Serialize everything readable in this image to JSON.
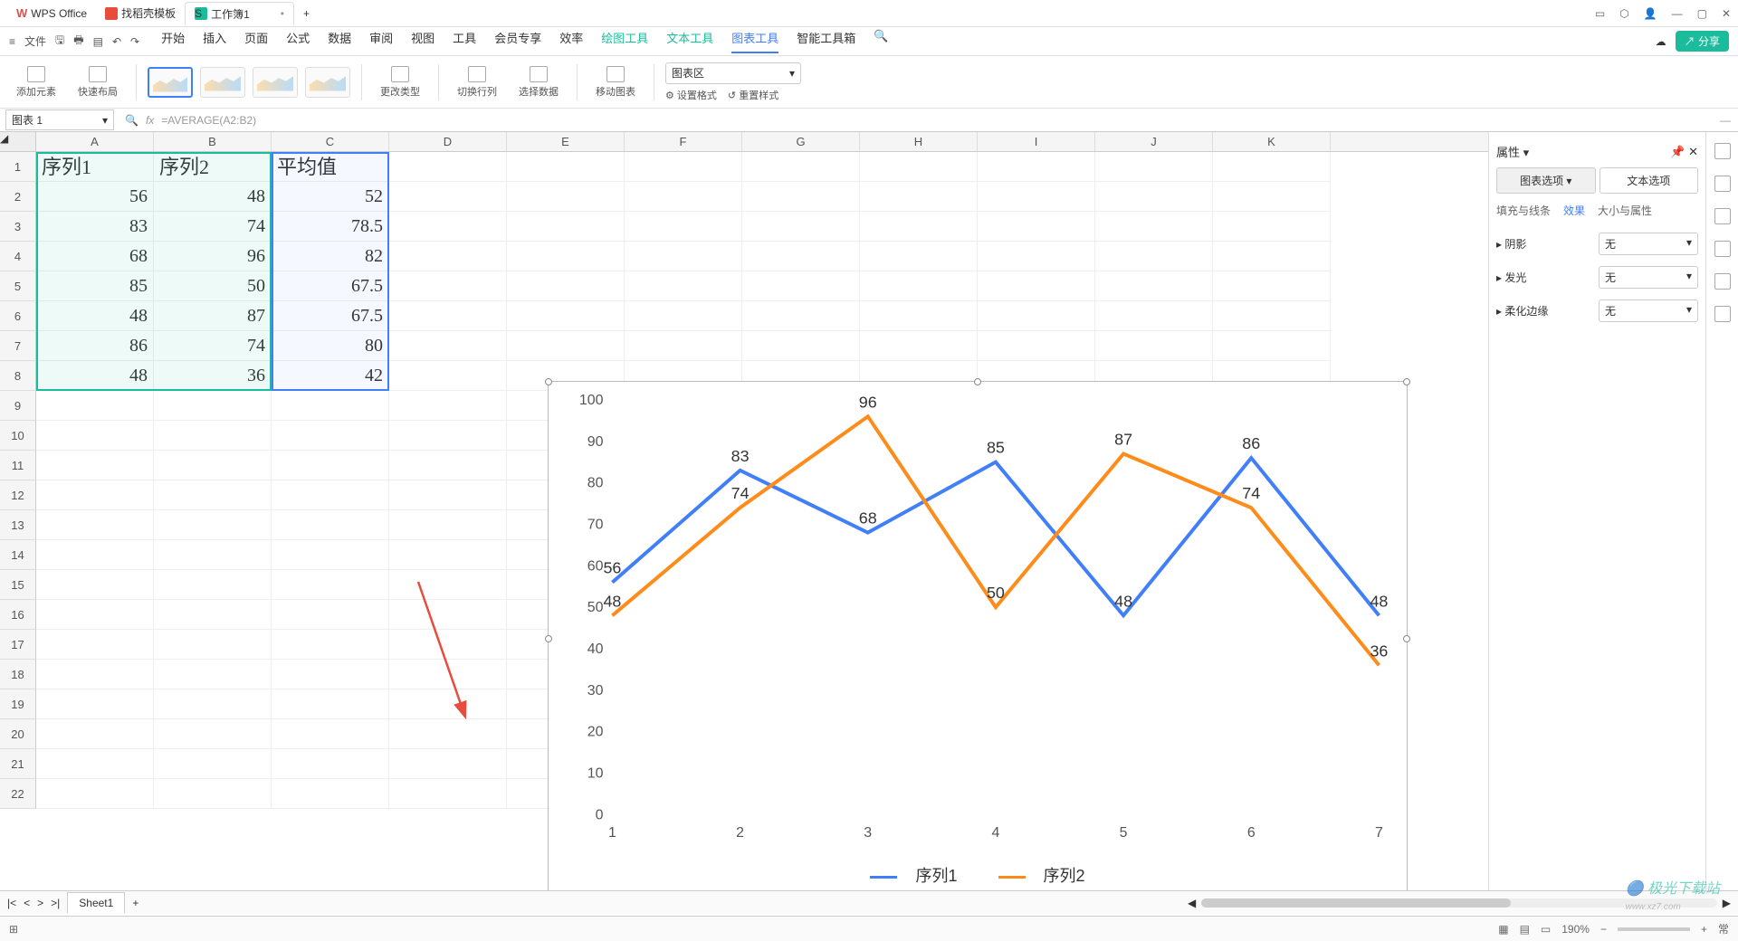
{
  "titlebar": {
    "app": "WPS Office",
    "tab_template": "找稻壳模板",
    "tab_workbook": "工作簿1",
    "plus": "+"
  },
  "menu": {
    "file": "文件",
    "items": [
      "开始",
      "插入",
      "页面",
      "公式",
      "数据",
      "审阅",
      "视图",
      "工具",
      "会员专享",
      "效率"
    ],
    "green_items": [
      "绘图工具",
      "文本工具"
    ],
    "active": "图表工具",
    "after": [
      "智能工具箱"
    ],
    "share": "分享"
  },
  "ribbon": {
    "add_element": "添加元素",
    "quick_layout": "快速布局",
    "change_type": "更改类型",
    "switch_rc": "切换行列",
    "select_data": "选择数据",
    "move_chart": "移动图表",
    "chart_area": "图表区",
    "set_format": "设置格式",
    "reset_style": "重置样式"
  },
  "formula": {
    "name": "图表 1",
    "fx": "=AVERAGE(A2:B2)"
  },
  "cols": [
    "A",
    "B",
    "C",
    "D",
    "E",
    "F",
    "G",
    "H",
    "I",
    "J",
    "K"
  ],
  "table": {
    "headers": [
      "序列1",
      "序列2",
      "平均值"
    ],
    "rows": [
      [
        "56",
        "48",
        "52"
      ],
      [
        "83",
        "74",
        "78.5"
      ],
      [
        "68",
        "96",
        "82"
      ],
      [
        "85",
        "50",
        "67.5"
      ],
      [
        "48",
        "87",
        "67.5"
      ],
      [
        "86",
        "74",
        "80"
      ],
      [
        "48",
        "36",
        "42"
      ]
    ]
  },
  "chart_data": {
    "type": "line",
    "categories": [
      "1",
      "2",
      "3",
      "4",
      "5",
      "6",
      "7"
    ],
    "series": [
      {
        "name": "序列1",
        "values": [
          56,
          83,
          68,
          85,
          48,
          86,
          48
        ],
        "color": "#417ff9"
      },
      {
        "name": "序列2",
        "values": [
          48,
          74,
          96,
          50,
          87,
          74,
          36
        ],
        "color": "#ff8c1a"
      }
    ],
    "ylim": [
      0,
      100
    ],
    "yticks": [
      0,
      10,
      20,
      30,
      40,
      50,
      60,
      70,
      80,
      90,
      100
    ],
    "title": "",
    "xlabel": "",
    "ylabel": ""
  },
  "props": {
    "title": "属性",
    "tab_chart": "图表选项",
    "tab_text": "文本选项",
    "sub_fill": "填充与线条",
    "sub_effect": "效果",
    "sub_size": "大小与属性",
    "shadow": "阴影",
    "glow": "发光",
    "soft": "柔化边缘",
    "none": "无"
  },
  "sheet": {
    "tab": "Sheet1",
    "nav": [
      "|<",
      "<",
      ">",
      ">|"
    ],
    "plus": "+"
  },
  "status": {
    "zoom": "190%",
    "mode": "常",
    "watermark": "极光下载站"
  }
}
